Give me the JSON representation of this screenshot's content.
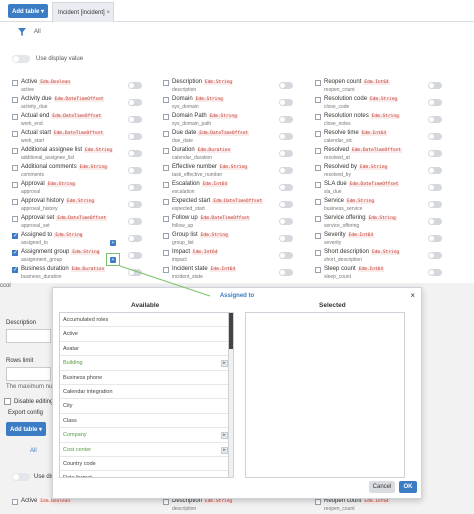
{
  "toolbar": {
    "add_table_label": "Add table ▾",
    "tab_label": "Incident [incident]",
    "tab_close": "×"
  },
  "filter": {
    "all_label": "All"
  },
  "display": {
    "label": "Use display value"
  },
  "columns": [
    [
      {
        "name": "Active",
        "type": "Edm.Boolean",
        "sub": "active",
        "checked": false
      },
      {
        "name": "Activity due",
        "type": "Edm.DateTimeOffset",
        "sub": "activity_due",
        "checked": false
      },
      {
        "name": "Actual end",
        "type": "Edm.DateTimeOffset",
        "sub": "work_end",
        "checked": false
      },
      {
        "name": "Actual start",
        "type": "Edm.DateTimeOffset",
        "sub": "work_start",
        "checked": false
      },
      {
        "name": "Additional assignee list",
        "type": "Edm.String",
        "sub": "additional_assignee_list",
        "checked": false
      },
      {
        "name": "Additional comments",
        "type": "Edm.String",
        "sub": "comments",
        "checked": false
      },
      {
        "name": "Approval",
        "type": "Edm.String",
        "sub": "approval",
        "checked": false
      },
      {
        "name": "Approval history",
        "type": "Edm.String",
        "sub": "approval_history",
        "checked": false
      },
      {
        "name": "Approval set",
        "type": "Edm.DateTimeOffset",
        "sub": "approval_set",
        "checked": false
      },
      {
        "name": "Assigned to",
        "type": "Edm.String",
        "sub": "assigned_to",
        "checked": true
      },
      {
        "name": "Assignment group",
        "type": "Edm.String",
        "sub": "assignment_group",
        "checked": true
      },
      {
        "name": "Business duration",
        "type": "Edm.Duration",
        "sub": "business_duration",
        "checked": true
      }
    ],
    [
      {
        "name": "Description",
        "type": "Edm.String",
        "sub": "description",
        "checked": false
      },
      {
        "name": "Domain",
        "type": "Edm.String",
        "sub": "sys_domain",
        "checked": false
      },
      {
        "name": "Domain Path",
        "type": "Edm.String",
        "sub": "sys_domain_path",
        "checked": false
      },
      {
        "name": "Due date",
        "type": "Edm.DateTimeOffset",
        "sub": "due_date",
        "checked": false
      },
      {
        "name": "Duration",
        "type": "Edm.Duration",
        "sub": "calendar_duration",
        "checked": false
      },
      {
        "name": "Effective number",
        "type": "Edm.String",
        "sub": "task_effective_number",
        "checked": false
      },
      {
        "name": "Escalation",
        "type": "Edm.Int64",
        "sub": "escalation",
        "checked": false
      },
      {
        "name": "Expected start",
        "type": "Edm.DateTimeOffset",
        "sub": "expected_start",
        "checked": false
      },
      {
        "name": "Follow up",
        "type": "Edm.DateTimeOffset",
        "sub": "follow_up",
        "checked": false
      },
      {
        "name": "Group list",
        "type": "Edm.String",
        "sub": "group_list",
        "checked": false
      },
      {
        "name": "Impact",
        "type": "Edm.Int64",
        "sub": "impact",
        "checked": false
      },
      {
        "name": "Incident state",
        "type": "Edm.Int64",
        "sub": "incident_state",
        "checked": false
      }
    ],
    [
      {
        "name": "Reopen count",
        "type": "Edm.Int64",
        "sub": "reopen_count",
        "checked": false
      },
      {
        "name": "Resolution code",
        "type": "Edm.String",
        "sub": "close_code",
        "checked": false
      },
      {
        "name": "Resolution notes",
        "type": "Edm.String",
        "sub": "close_notes",
        "checked": false
      },
      {
        "name": "Resolve time",
        "type": "Edm.Int64",
        "sub": "calendar_stc",
        "checked": false
      },
      {
        "name": "Resolved",
        "type": "Edm.DateTimeOffset",
        "sub": "resolved_at",
        "checked": false
      },
      {
        "name": "Resolved by",
        "type": "Edm.String",
        "sub": "resolved_by",
        "checked": false
      },
      {
        "name": "SLA due",
        "type": "Edm.DateTimeOffset",
        "sub": "sla_due",
        "checked": false
      },
      {
        "name": "Service",
        "type": "Edm.String",
        "sub": "business_service",
        "checked": false
      },
      {
        "name": "Service offering",
        "type": "Edm.String",
        "sub": "service_offering",
        "checked": false
      },
      {
        "name": "Severity",
        "type": "Edm.Int64",
        "sub": "severity",
        "checked": false
      },
      {
        "name": "Short description",
        "type": "Edm.String",
        "sub": "short_description",
        "checked": false
      },
      {
        "name": "Sleep count",
        "type": "Edm.Int64",
        "sub": "sleep_count",
        "checked": false
      }
    ]
  ],
  "background": {
    "col_label": "ccol",
    "description_label": "Description",
    "rows_limit_label": "Rows limit",
    "max_rows_label": "The maximum num",
    "disable_editing_label": "Disable editing",
    "export_config_label": "Export config",
    "add_table_label": "Add table ▾",
    "all_label": "All",
    "use_display_label": "Use displ",
    "bottom_left_name": "Active",
    "bottom_left_type": "Edm.Boolean",
    "bottom_mid_name": "Description",
    "bottom_mid_type": "Edm.String",
    "bottom_mid_sub": "description",
    "bottom_right_name": "Reopen count",
    "bottom_right_type": "Edm.Int64",
    "bottom_right_sub": "reopen_count"
  },
  "modal": {
    "title": "Assigned to",
    "close": "×",
    "available_label": "Available",
    "selected_label": "Selected",
    "items": [
      {
        "label": "Accumulated roles",
        "sub": false
      },
      {
        "label": "Active",
        "sub": false
      },
      {
        "label": "Avatar",
        "sub": false
      },
      {
        "label": "Building",
        "sub": true
      },
      {
        "label": "Business phone",
        "sub": false
      },
      {
        "label": "Calendar integration",
        "sub": false
      },
      {
        "label": "City",
        "sub": false
      },
      {
        "label": "Class",
        "sub": false
      },
      {
        "label": "Company",
        "sub": true
      },
      {
        "label": "Cost center",
        "sub": true
      },
      {
        "label": "Country code",
        "sub": false
      },
      {
        "label": "Date format",
        "sub": false
      }
    ],
    "cancel_label": "Cancel",
    "ok_label": "OK"
  },
  "colors": {
    "accent": "#3b7cc4",
    "type_text": "#c0392b",
    "sub_field": "#5a9a44",
    "highlight": "#7cc26c"
  }
}
